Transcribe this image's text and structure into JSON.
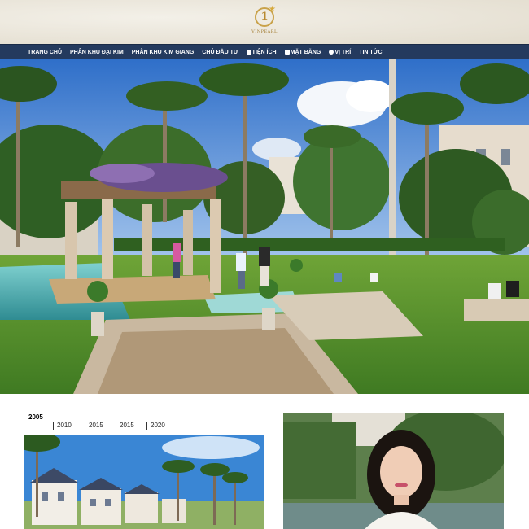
{
  "header": {
    "logo_text": "VINPEARL"
  },
  "nav": {
    "items": [
      {
        "label": "TRANG CHỦ",
        "icon": ""
      },
      {
        "label": "PHÂN KHU ĐẠI KIM",
        "icon": ""
      },
      {
        "label": "PHÂN KHU KIM GIANG",
        "icon": ""
      },
      {
        "label": "CHỦ ĐẦU TƯ",
        "icon": ""
      },
      {
        "label": "TIỆN ÍCH",
        "icon": "building-icon"
      },
      {
        "label": "MẶT BẰNG",
        "icon": "grid-icon"
      },
      {
        "label": "VỊ TRÍ",
        "icon": "globe-icon"
      },
      {
        "label": "TIN TỨC",
        "icon": ""
      }
    ]
  },
  "timeline": {
    "active": "2005",
    "years": [
      "2010",
      "2015",
      "2015",
      "2020"
    ]
  },
  "colors": {
    "nav_bg": "#243a5e",
    "logo_gold": "#c9a24a"
  }
}
